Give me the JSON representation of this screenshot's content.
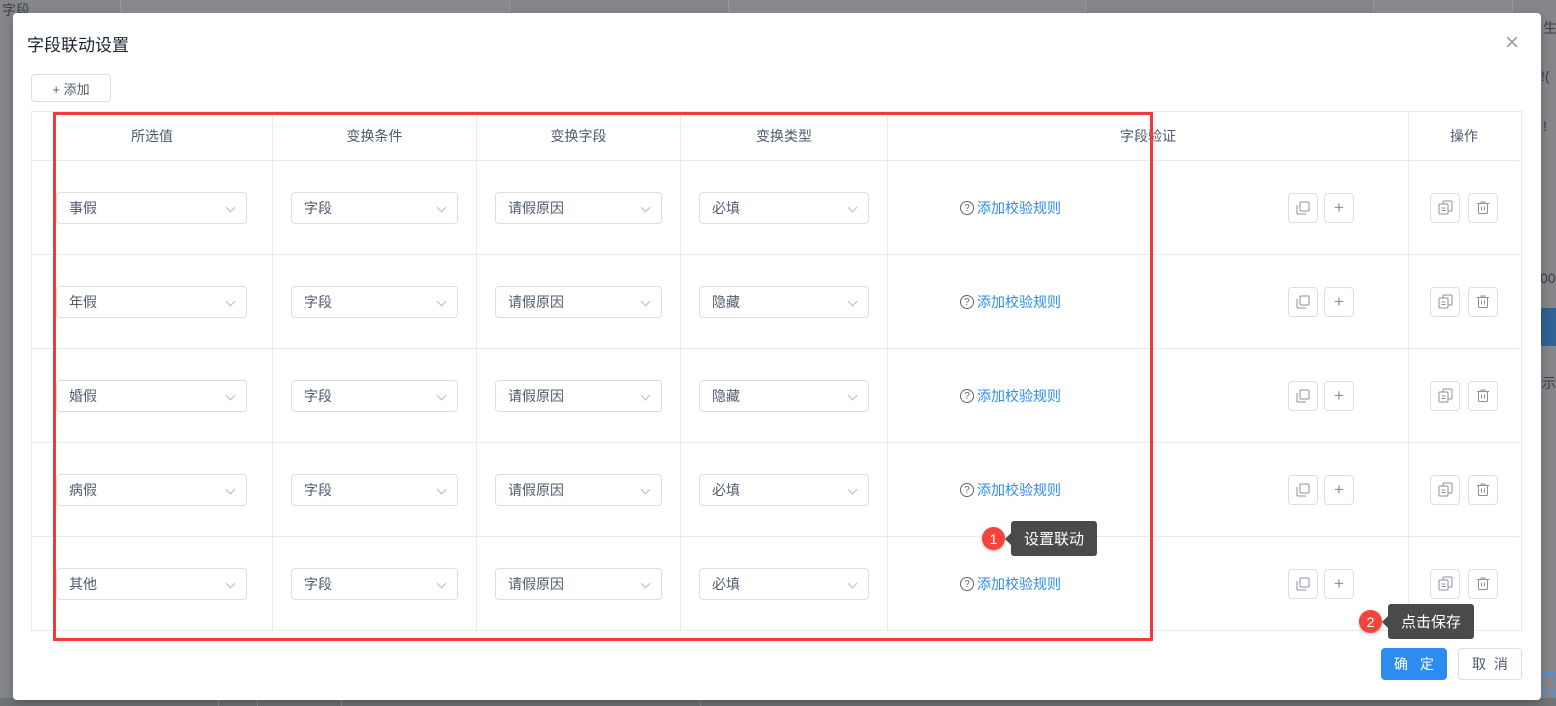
{
  "background": {
    "top_left_text": "字段",
    "right_fragments": {
      "f1": "生",
      "f2": "!(",
      "f3": "!",
      "f4": "00",
      "f5": "示"
    }
  },
  "modal": {
    "title": "字段联动设置",
    "close_icon": "×",
    "add_button_label": "+ 添加"
  },
  "table": {
    "headers": [
      "所选值",
      "变换条件",
      "变换字段",
      "变换类型",
      "字段验证",
      "操作"
    ],
    "add_rule_label": "添加校验规则",
    "help_icon": "?",
    "plus_icon": "+",
    "rows": [
      {
        "selected_value": "事假",
        "condition": "字段",
        "field": "请假原因",
        "type": "必填"
      },
      {
        "selected_value": "年假",
        "condition": "字段",
        "field": "请假原因",
        "type": "隐藏"
      },
      {
        "selected_value": "婚假",
        "condition": "字段",
        "field": "请假原因",
        "type": "隐藏"
      },
      {
        "selected_value": "病假",
        "condition": "字段",
        "field": "请假原因",
        "type": "必填"
      },
      {
        "selected_value": "其他",
        "condition": "字段",
        "field": "请假原因",
        "type": "必填"
      }
    ]
  },
  "annotations": [
    {
      "number": "1",
      "label": "设置联动"
    },
    {
      "number": "2",
      "label": "点击保存"
    }
  ],
  "footer": {
    "confirm": "确 定",
    "cancel": "取 消"
  },
  "colors": {
    "annotation_red": "#f13a3a",
    "link_blue": "#2d8cf0",
    "primary_blue": "#2d8cf0",
    "border_gray": "#dcdee2"
  }
}
